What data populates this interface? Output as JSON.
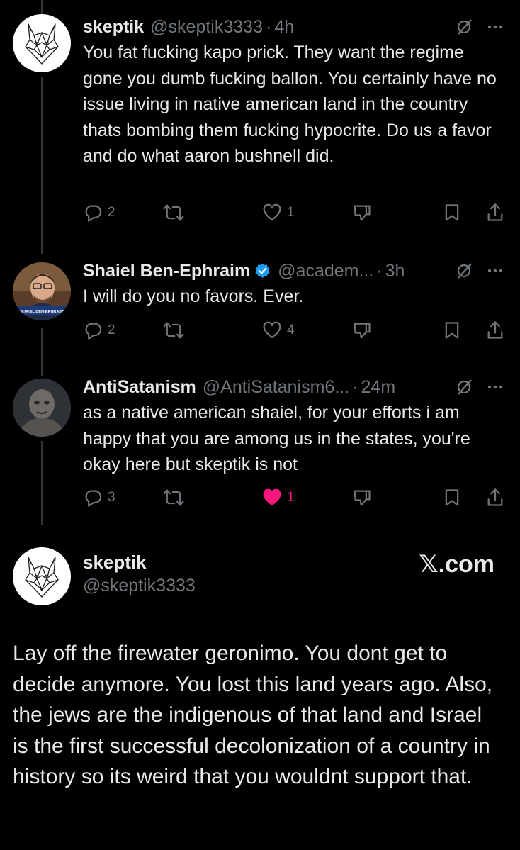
{
  "tweets": [
    {
      "name": "skeptik",
      "handle": "@skeptik3333",
      "separator": "·",
      "time": "4h",
      "avatar_icon": "wolf-logo-icon",
      "verified": false,
      "text": "You fat fucking kapo prick. They want the regime gone you dumb fucking ballon. You certainly have no issue living in native american land in the country thats bombing them fucking hypocrite. Do us a favor and do what aaron bushnell did.",
      "replies": "2",
      "retweets": "",
      "likes": "1",
      "liked": false
    },
    {
      "name": "Shaiel Ben-Ephraim",
      "handle": "@academ...",
      "separator": "·",
      "time": "3h",
      "avatar_icon": "profile-photo",
      "avatar_caption": "SHAIEL BEN-EPHRAIM",
      "verified": true,
      "text": "I will do you no favors. Ever.",
      "replies": "2",
      "retweets": "",
      "likes": "4",
      "liked": false
    },
    {
      "name": "AntiSatanism",
      "handle": "@AntiSatanism6...",
      "separator": "·",
      "time": "24m",
      "avatar_icon": "profile-photo",
      "verified": false,
      "text": "as a native american shaiel, for your efforts i am happy that you are among us in the states, you're okay here but skeptik is not",
      "replies": "3",
      "retweets": "",
      "likes": "1",
      "liked": true
    }
  ],
  "card": {
    "name": "skeptik",
    "handle": "@skeptik3333",
    "brand_x": "𝕏",
    "brand_suffix": ".com",
    "text": "Lay off the firewater geronimo. You dont get to decide anymore. You lost this land years ago. Also, the jews are the indigenous of that land and Israel is the first successful decolonization of a country in history so its weird that you wouldnt support that."
  },
  "colors": {
    "background": "#000000",
    "text_primary": "#e7e9ea",
    "text_secondary": "#71767b",
    "like_active": "#f91880",
    "verified_blue": "#1d9bf0"
  }
}
